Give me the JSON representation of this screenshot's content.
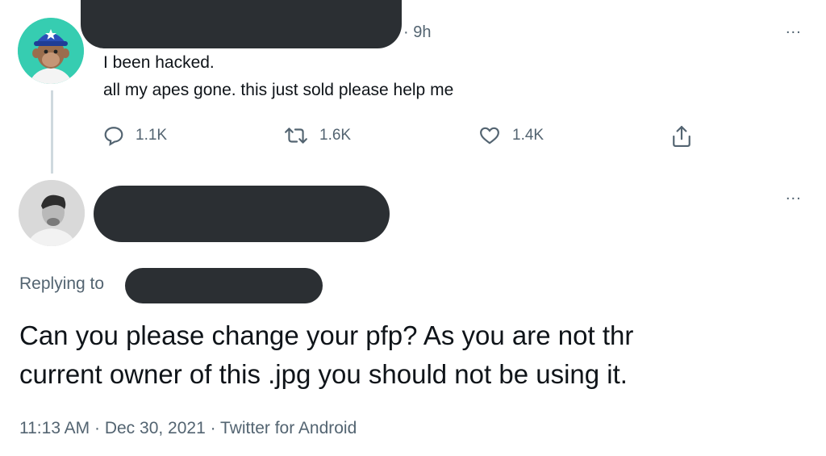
{
  "tweet1": {
    "time": "· 9h",
    "lines": [
      "I been hacked.",
      "all my apes gone. this just sold please help me"
    ],
    "actions": [
      {
        "icon": "reply-icon",
        "count": "1.1K"
      },
      {
        "icon": "retweet-icon",
        "count": "1.6K"
      },
      {
        "icon": "like-icon",
        "count": "1.4K"
      },
      {
        "icon": "share-icon",
        "count": ""
      }
    ],
    "more": "..."
  },
  "tweet2": {
    "more": "...",
    "replying_to": "Replying to",
    "text_lines": [
      "Can you please change your pfp? As you are not thr",
      "current owner of this .jpg you should not be using it."
    ],
    "meta": "11:13 AM · Dec 30, 2021 · Twitter for Android"
  },
  "colors": {
    "redaction": "#2b2f33",
    "secondary_text": "#536471",
    "primary_text": "#0f1419",
    "thread_line": "#cfd9de"
  }
}
